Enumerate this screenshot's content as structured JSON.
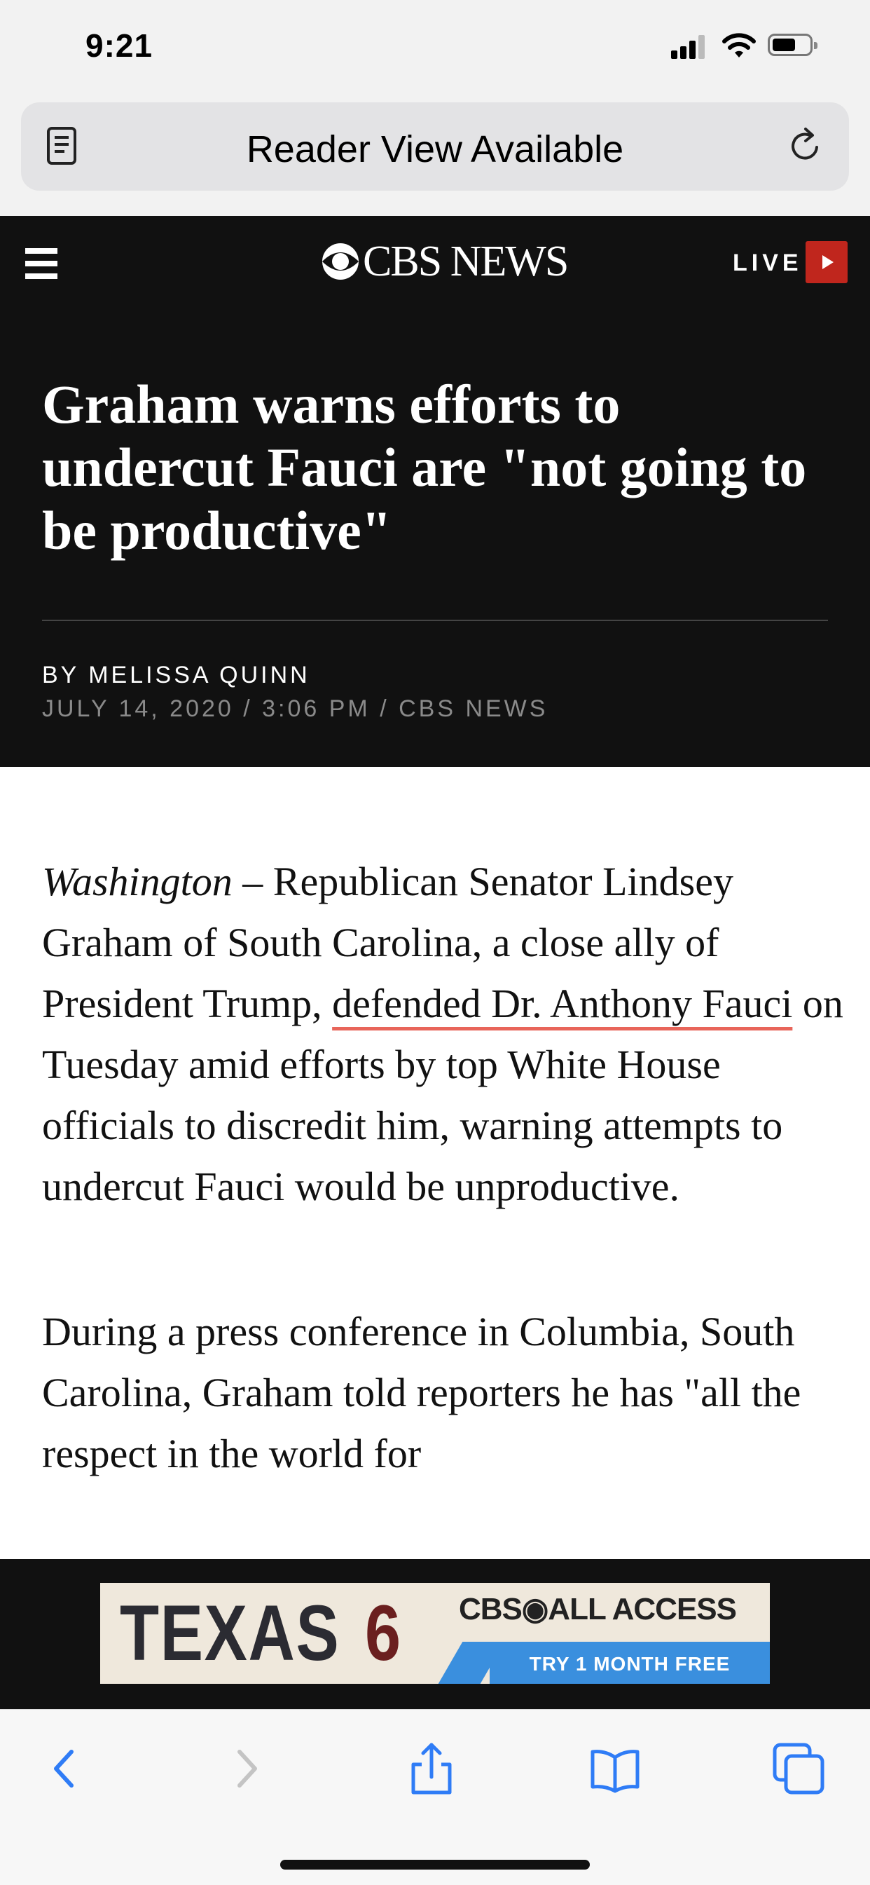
{
  "status_bar": {
    "time": "9:21"
  },
  "url_bar": {
    "text": "Reader View Available"
  },
  "site_header": {
    "logo": "CBS NEWS",
    "live_label": "LIVE"
  },
  "article_header": {
    "headline": "Graham warns efforts to undercut Fauci are \"not going to be productive\"",
    "byline": "BY MELISSA QUINN",
    "dateline": "JULY 14, 2020 / 3:06 PM / CBS NEWS"
  },
  "article": {
    "p1_dateline": "Washington",
    "p1_before": " – Republican Senator Lindsey Graham of South Carolina, a close ally of President Trump, ",
    "p1_link": "defended Dr. Anthony Fauci",
    "p1_after": " on Tuesday amid efforts by top White House officials to discredit him, warning attempts to undercut Fauci would be unproductive.",
    "p2": "During a press conference in Columbia, South Carolina, Graham told reporters he has \"all the respect in the world for"
  },
  "ad": {
    "texas": "TEXAS",
    "six": "6",
    "brand": "CBS◉ALL ACCESS",
    "cta": "TRY 1 MONTH FREE"
  },
  "colors": {
    "header_bg": "#111111",
    "live_red": "#c0261d",
    "link_underline": "#e8655a",
    "ios_blue": "#2f7cf6"
  },
  "toolbar": {
    "icons": [
      "back-icon",
      "forward-icon",
      "share-icon",
      "bookmarks-icon",
      "tabs-icon"
    ]
  }
}
